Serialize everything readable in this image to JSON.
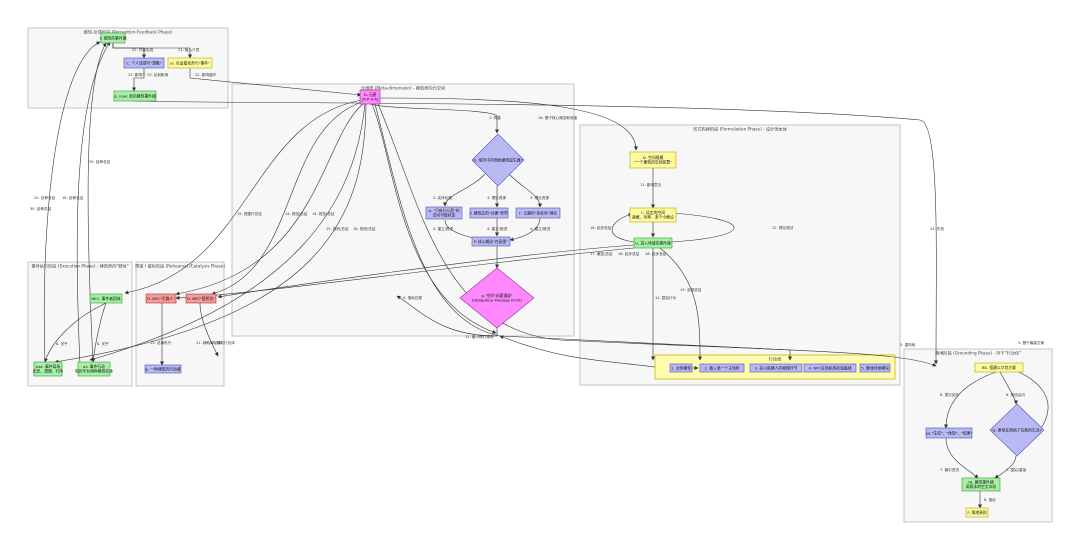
{
  "colors": {
    "green": "#a6f0a6",
    "green_stroke": "#3a9a3a",
    "yellow": "#fffaa0",
    "yellow_stroke": "#b5a800",
    "purple": "#b9b9f5",
    "purple_stroke": "#5050b0",
    "red": "#f59b9b",
    "red_stroke": "#b03030",
    "pink": "#ff88ff",
    "pink_stroke": "#a020a0",
    "cluster_fill": "#f7f7f7",
    "cluster_stroke": "#b8b8b8"
  },
  "clusters": [
    {
      "id": "c_perception",
      "title": "感知-反馈阶段 (Perception-Feedback Phase)"
    },
    {
      "id": "c_meta",
      "title": "元维度 (Meta-dimension) - 建筑师的元空间"
    },
    {
      "id": "c_formulation",
      "title": "形式构建阶段 (Formulation Phase) - 设计师本体"
    },
    {
      "id": "c_execution",
      "title": "事件执行阶段 (Execution Phase) - 建筑师的\"肢体\""
    },
    {
      "id": "c_catalysis",
      "title": "预演 / 催化阶段 (Rehearsal /Catalysis Phase)"
    },
    {
      "id": "c_grounding",
      "title": "落地阶段 (Grounding Phase) - AI于\"行动化\""
    },
    {
      "id": "c_story",
      "title": "行动线"
    }
  ],
  "nodes": [
    {
      "id": "n_percept",
      "lines": [
        "F. 感知的事件镜"
      ],
      "color": "green"
    },
    {
      "id": "n_thinking",
      "lines": [
        "C. 个人话语与\"想象\""
      ],
      "color": "purple"
    },
    {
      "id": "n_catalyst",
      "lines": [
        "el. 社会催化剂与\"事件\""
      ],
      "color": "yellow"
    },
    {
      "id": "n_new",
      "lines": [
        "q. new: 新的建筑事件镜"
      ],
      "color": "green"
    },
    {
      "id": "n_meta",
      "lines": [
        "S₀ 元建",
        "[A·P·V·A]"
      ],
      "color": "pink"
    },
    {
      "id": "n_decision",
      "lines": [
        "Q. 城市中的原始建筑诞生器?"
      ],
      "color": "purple_diamond"
    },
    {
      "id": "n_opt1",
      "lines": [
        "a. \"只有什么是\"的",
        "空间可能状态"
      ],
      "color": "purple"
    },
    {
      "id": "n_opt2",
      "lines": [
        "f. 建筑总的\"共建\"哲学"
      ],
      "color": "purple"
    },
    {
      "id": "n_opt3",
      "lines": [
        "Γ. 元建的\"多处序\"理论"
      ],
      "color": "purple"
    },
    {
      "id": "n_merge",
      "lines": [
        "P. 核心概念\"在画里\""
      ],
      "color": "purple"
    },
    {
      "id": "n_passage",
      "lines": [
        "g. 空间\"必要通道\"",
        "(Obligatory Passage Point)"
      ],
      "color": "pink_diamond"
    },
    {
      "id": "n_f_define",
      "lines": [
        "D. 空间规模",
        "\"一个建筑的空间装置\""
      ],
      "color": "yellow"
    },
    {
      "id": "n_f_intent",
      "lines": [
        "C. 设定的空间",
        "高概、功率、多个小概论"
      ],
      "color": "yellow"
    },
    {
      "id": "n_f_event",
      "lines": [
        "U. 进入场域的事件镜"
      ],
      "color": "green"
    },
    {
      "id": "n_exec_body",
      "lines": [
        "NEC. 事件者团体"
      ],
      "color": "green"
    },
    {
      "id": "n_exec_left",
      "lines": [
        "exe. 事件局场",
        "历史、遗憾、行序"
      ],
      "color": "green"
    },
    {
      "id": "n_exec_right",
      "lines": [
        "av. 事件行动",
        "和的平台两种建筑实体"
      ],
      "color": "green"
    },
    {
      "id": "n_cat_npc1",
      "lines": [
        "H. NPC\"引路人\""
      ],
      "color": "red"
    },
    {
      "id": "n_cat_npc2",
      "lines": [
        "H. NPC\"搭桥员\""
      ],
      "color": "red"
    },
    {
      "id": "n_cat_sim",
      "lines": [
        "φ. 一种建筑的行动者"
      ],
      "color": "purple"
    },
    {
      "id": "n_st1",
      "lines": [
        "1. 业务模型"
      ],
      "color": "purple"
    },
    {
      "id": "n_st2",
      "lines": [
        "2. 植入某一个主场所"
      ],
      "color": "purple"
    },
    {
      "id": "n_st3",
      "lines": [
        "3. 在以前建人的物理环节"
      ],
      "color": "purple"
    },
    {
      "id": "n_st4",
      "lines": [
        "4. NPC在场机构的思路线"
      ],
      "color": "purple"
    },
    {
      "id": "n_st5",
      "lines": [
        "5. 整体时候模块"
      ],
      "color": "purple"
    },
    {
      "id": "n_g_proto",
      "lines": [
        "BS. 搭建以众包方案"
      ],
      "color": "yellow"
    },
    {
      "id": "n_g_test",
      "lines": [
        "ea.\"生成\"、\"体现\"、\"结果\""
      ],
      "color": "purple"
    },
    {
      "id": "n_g_check",
      "lines": [
        "Q. 原型在原始了在新的生活?"
      ],
      "color": "purple_diamond"
    },
    {
      "id": "n_g_update",
      "lines": [
        "IH. 建筑事件镜",
        "高版本的空文本机"
      ],
      "color": "green"
    },
    {
      "id": "n_g_final",
      "lines": [
        "F. 落地原则"
      ],
      "color": "yellow"
    }
  ],
  "edge_labels": [
    "22. 内部实现",
    "21. 植入介意",
    "23. 影响个",
    "23. 反射影响",
    "22. 影响循环",
    "1. 构建",
    "16. 基于核心概念和深度",
    "2. 实体化路",
    "3. 理论资源",
    "3. 理论资源",
    "4. 建立/推进",
    "4. 建立/推进",
    "4. 建立/推进",
    "11. 影响意见",
    "16. 起步总结",
    "12. 理论调试",
    "17. 撤控/总结",
    "16. 起步总结",
    "16. 起步总结",
    "19. 全程总结",
    "12. 整后行为",
    "5. 建构段",
    "20. 延伸总结",
    "18. 延伸总结",
    "13. 总局机行",
    "19. 规整行总结",
    "14. 规范/总结",
    "14. 规范/总结",
    "15. 规则/总结",
    "16. 规则/总结",
    "9. 落地过程",
    "12. 最小核心规则",
    "8. 关乎",
    "8. 关乎",
    "11. 辅助行总体",
    "15. 辅助行总体",
    "24. 失效",
    "5. 基于最高方案",
    "6. 提交实际",
    "6. 按设后问",
    "7. 最引进流",
    "7. 整后/直接",
    "8. 推优",
    "29. 延伸总结",
    "30. 延伸总结"
  ]
}
